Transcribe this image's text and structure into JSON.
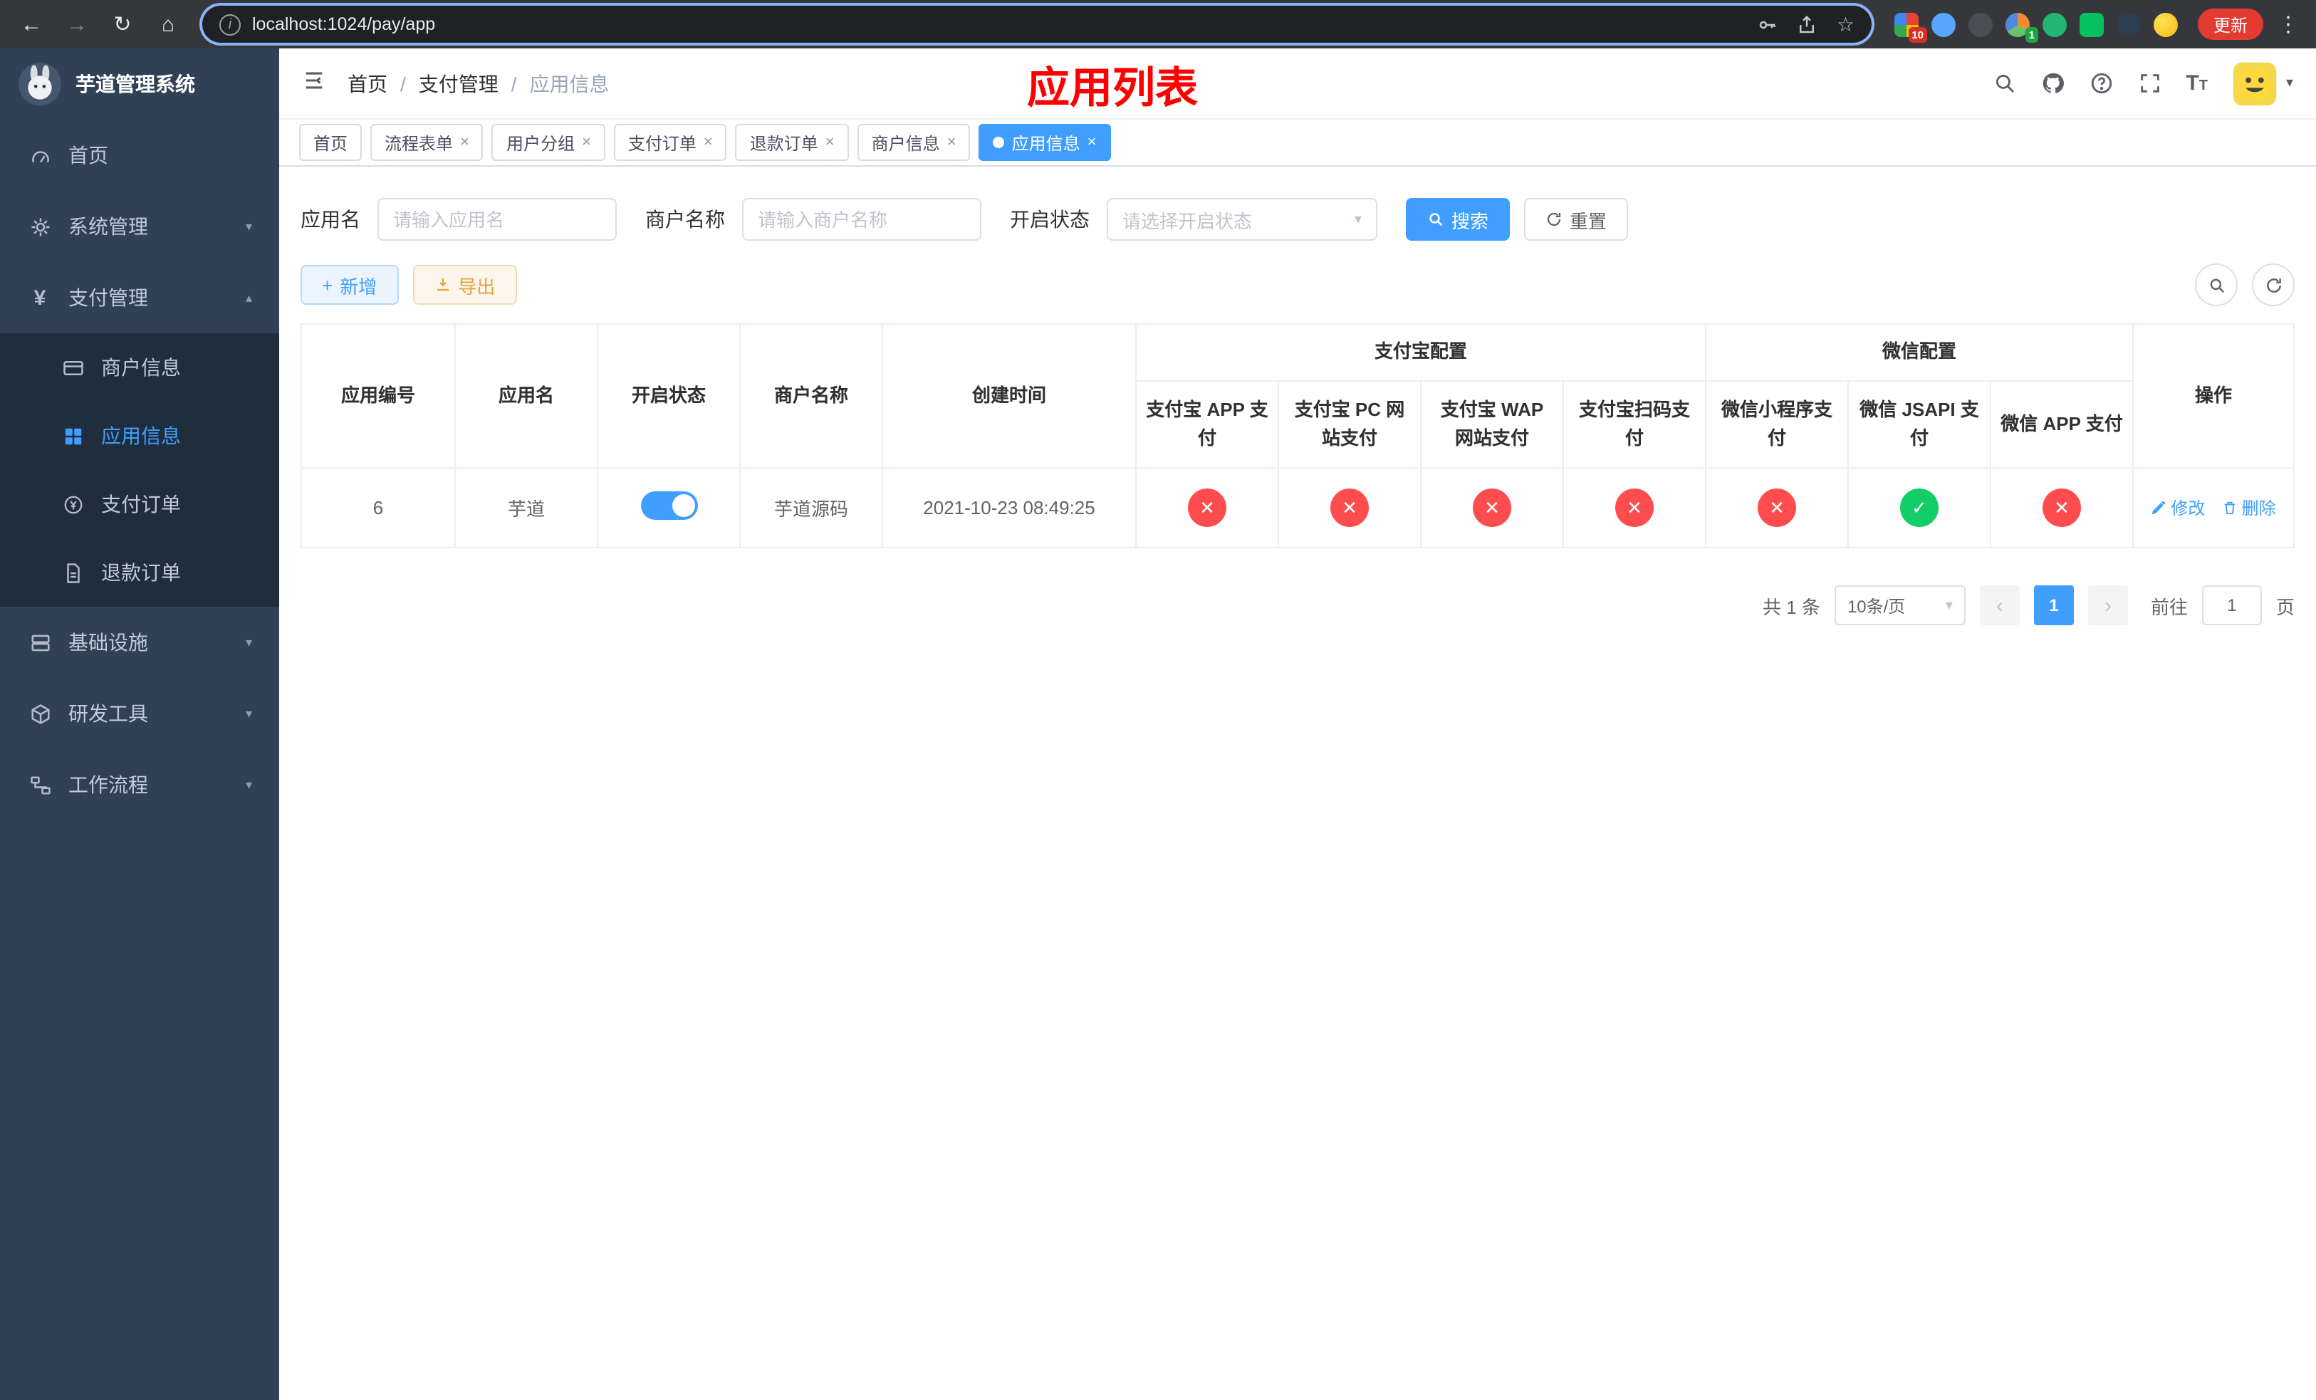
{
  "colors": {
    "accent": "#409eff",
    "danger": "#ff4d4f",
    "success": "#13ce66",
    "warning": "#e6a23c",
    "title_red": "#ff0000",
    "sidebar_bg": "#304156",
    "submenu_bg": "#1f2d3d"
  },
  "icons": {
    "back": "←",
    "forward": "→",
    "reload": "↻",
    "home": "⌂",
    "dots": "⋮",
    "star": "☆",
    "info": "i",
    "caret": "▾",
    "chev_down": "▾",
    "chev_up": "▴",
    "plus": "+",
    "check": "✓",
    "cross": "✕",
    "prev": "‹",
    "next": "›",
    "close": "×",
    "yen": "¥",
    "download": "↓"
  },
  "browser": {
    "url": "localhost:1024/pay/app",
    "update_button": "更新",
    "badge_apps": "10",
    "badge_profile": "1"
  },
  "sidebar": {
    "app_title": "芋道管理系统",
    "items": [
      {
        "label": "首页"
      },
      {
        "label": "系统管理"
      },
      {
        "label": "支付管理",
        "children": [
          {
            "label": "商户信息"
          },
          {
            "label": "应用信息"
          },
          {
            "label": "支付订单"
          },
          {
            "label": "退款订单"
          }
        ]
      },
      {
        "label": "基础设施"
      },
      {
        "label": "研发工具"
      },
      {
        "label": "工作流程"
      }
    ]
  },
  "header": {
    "breadcrumb": [
      "首页",
      "支付管理",
      "应用信息"
    ],
    "separator": "/",
    "page_title": "应用列表"
  },
  "tabs": [
    {
      "label": "首页"
    },
    {
      "label": "流程表单"
    },
    {
      "label": "用户分组"
    },
    {
      "label": "支付订单"
    },
    {
      "label": "退款订单"
    },
    {
      "label": "商户信息"
    },
    {
      "label": "应用信息"
    }
  ],
  "filters": {
    "app_name_label": "应用名",
    "app_name_placeholder": "请输入应用名",
    "merchant_label": "商户名称",
    "merchant_placeholder": "请输入商户名称",
    "status_label": "开启状态",
    "status_placeholder": "请选择开启状态",
    "search": "搜索",
    "reset": "重置"
  },
  "toolbar": {
    "add": "新增",
    "export": "导出"
  },
  "table": {
    "headers": {
      "app_id": "应用编号",
      "app_name": "应用名",
      "status": "开启状态",
      "merchant": "商户名称",
      "created": "创建时间",
      "group_alipay": "支付宝配置",
      "group_wechat": "微信配置",
      "alipay_app": "支付宝 APP 支付",
      "alipay_pc": "支付宝 PC 网站支付",
      "alipay_wap": "支付宝 WAP 网站支付",
      "alipay_qr": "支付宝扫码支付",
      "wx_lite": "微信小程序支付",
      "wx_jsapi": "微信 JSAPI 支付",
      "wx_app": "微信 APP 支付",
      "actions": "操作"
    },
    "rows": [
      {
        "id": "6",
        "name": "芋道",
        "enabled": true,
        "merchant": "芋道源码",
        "created": "2021-10-23 08:49:25",
        "channels": [
          "no",
          "no",
          "no",
          "no",
          "no",
          "yes",
          "no"
        ],
        "edit": "修改",
        "delete": "删除"
      }
    ]
  },
  "pagination": {
    "total": "共 1 条",
    "size": "10条/页",
    "page": "1",
    "goto": "前往",
    "unit": "页",
    "goto_value": "1"
  }
}
